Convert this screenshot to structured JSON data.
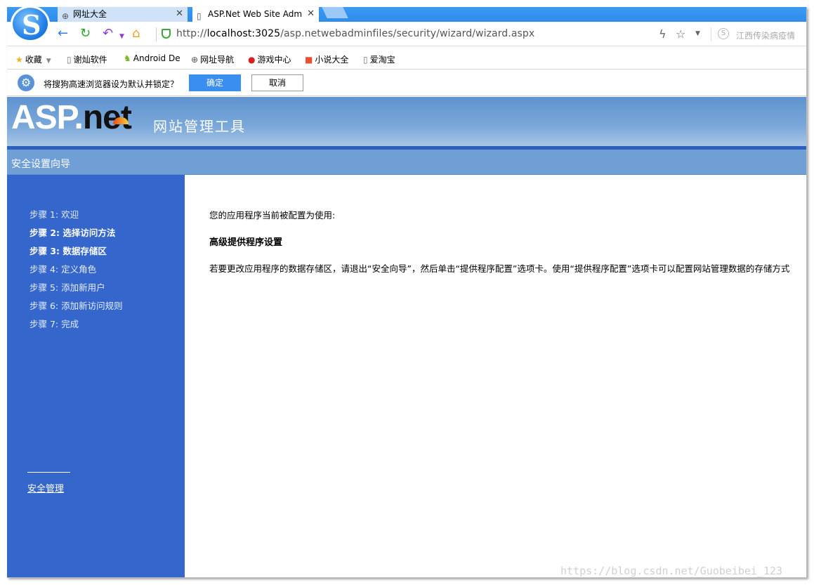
{
  "browser": {
    "tabs": [
      {
        "label": "网址大全",
        "icon": "globe-icon"
      },
      {
        "label": "ASP.Net Web Site Adm",
        "icon": "page-icon"
      }
    ],
    "url": "http://localhost:3025/asp.netwebadminfiles/security/wizard/wizard.aspx",
    "news_text": "江西传染病疫情",
    "bookmarks": [
      {
        "label": "收藏",
        "icon": "star-icon"
      },
      {
        "label": "谢灿软件",
        "icon": "page-icon"
      },
      {
        "label": "Android De",
        "icon": "android-icon"
      },
      {
        "label": "网址导航",
        "icon": "globe-icon"
      },
      {
        "label": "游戏中心",
        "icon": "game-icon"
      },
      {
        "label": "小说大全",
        "icon": "book-icon"
      },
      {
        "label": "爱淘宝",
        "icon": "page-icon"
      }
    ],
    "default_prompt": {
      "text": "将搜狗高速浏览器设为默认并锁定？",
      "ok": "确定",
      "cancel": "取消"
    }
  },
  "header": {
    "logo_asp": "ASP.",
    "logo_net": "net",
    "title": "网站管理工具",
    "wizard_title": "安全设置向导"
  },
  "sidebar": {
    "steps": [
      {
        "label": "步骤 1: 欢迎",
        "active": false
      },
      {
        "label": "步骤 2: 选择访问方法",
        "active": true
      },
      {
        "label": "步骤 3: 数据存储区",
        "active": true
      },
      {
        "label": "步骤 4: 定义角色",
        "active": false
      },
      {
        "label": "步骤 5: 添加新用户",
        "active": false
      },
      {
        "label": "步骤 6: 添加新访问规则",
        "active": false
      },
      {
        "label": "步骤 7: 完成",
        "active": false
      }
    ],
    "security_link": "安全管理"
  },
  "content": {
    "line1": "您的应用程序当前被配置为使用:",
    "heading": "高级提供程序设置",
    "line2": "若要更改应用程序的数据存储区，请退出“安全向导”，然后单击“提供程序配置”选项卡。使用“提供程序配置”选项卡可以配置网站管理数据的存储方式"
  },
  "watermark": "https://blog.csdn.net/Guobeibei_123",
  "colors": {
    "sidebar_bg": "#3466cc",
    "header_bg": "#6f9fd5",
    "ok_button": "#3a8ef0"
  }
}
